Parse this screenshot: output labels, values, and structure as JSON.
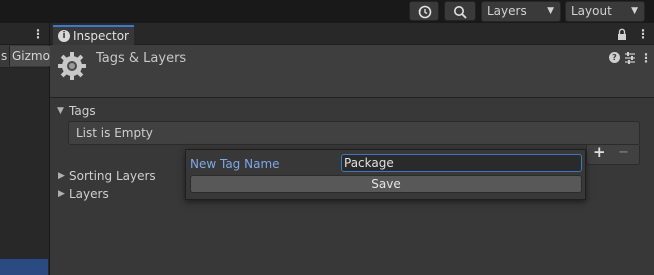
{
  "toolbar": {
    "history_icon": "history-icon",
    "search_icon": "search-icon",
    "layers_dropdown": "Layers",
    "layout_dropdown": "Layout",
    "more_icon": "⋮"
  },
  "left_panel": {
    "tab_fragment": "s",
    "gizmos_label": "Gizmo"
  },
  "inspector": {
    "tab_label": "Inspector",
    "title": "Tags & Layers",
    "lock_icon": "lock-icon",
    "menu_icon": "⋮"
  },
  "tags": {
    "header": "Tags",
    "empty_text": "List is Empty",
    "add_label": "+",
    "remove_label": "−"
  },
  "sections": {
    "sorting_layers": "Sorting Layers",
    "layers": "Layers"
  },
  "popup": {
    "field_label": "New Tag Name",
    "field_value": "Package",
    "save_label": "Save"
  }
}
